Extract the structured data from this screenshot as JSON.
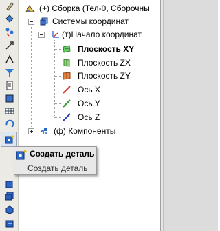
{
  "tree": {
    "root": "(+) Сборка (Тел-0, Сборочны",
    "coord_systems": "Системы координат",
    "origin": "(т)Начало координат",
    "items": [
      {
        "label": "Плоскость XY",
        "bold": true
      },
      {
        "label": "Плоскость ZX",
        "bold": false
      },
      {
        "label": "Плоскость ZY",
        "bold": false
      },
      {
        "label": "Ось X",
        "bold": false
      },
      {
        "label": "Ось Y",
        "bold": false
      },
      {
        "label": "Ось Z",
        "bold": false
      }
    ],
    "components": "(ф) Компоненты"
  },
  "tooltip": {
    "title": "Создать деталь",
    "description": "Создать деталь"
  },
  "colors": {
    "plane_xy": "#6bd16b",
    "plane_zx": "#8fd67a",
    "plane_zy": "#e2843e",
    "axis_x": "#d23a2a",
    "axis_y": "#2e9a2e",
    "axis_z": "#2a3ab8"
  }
}
